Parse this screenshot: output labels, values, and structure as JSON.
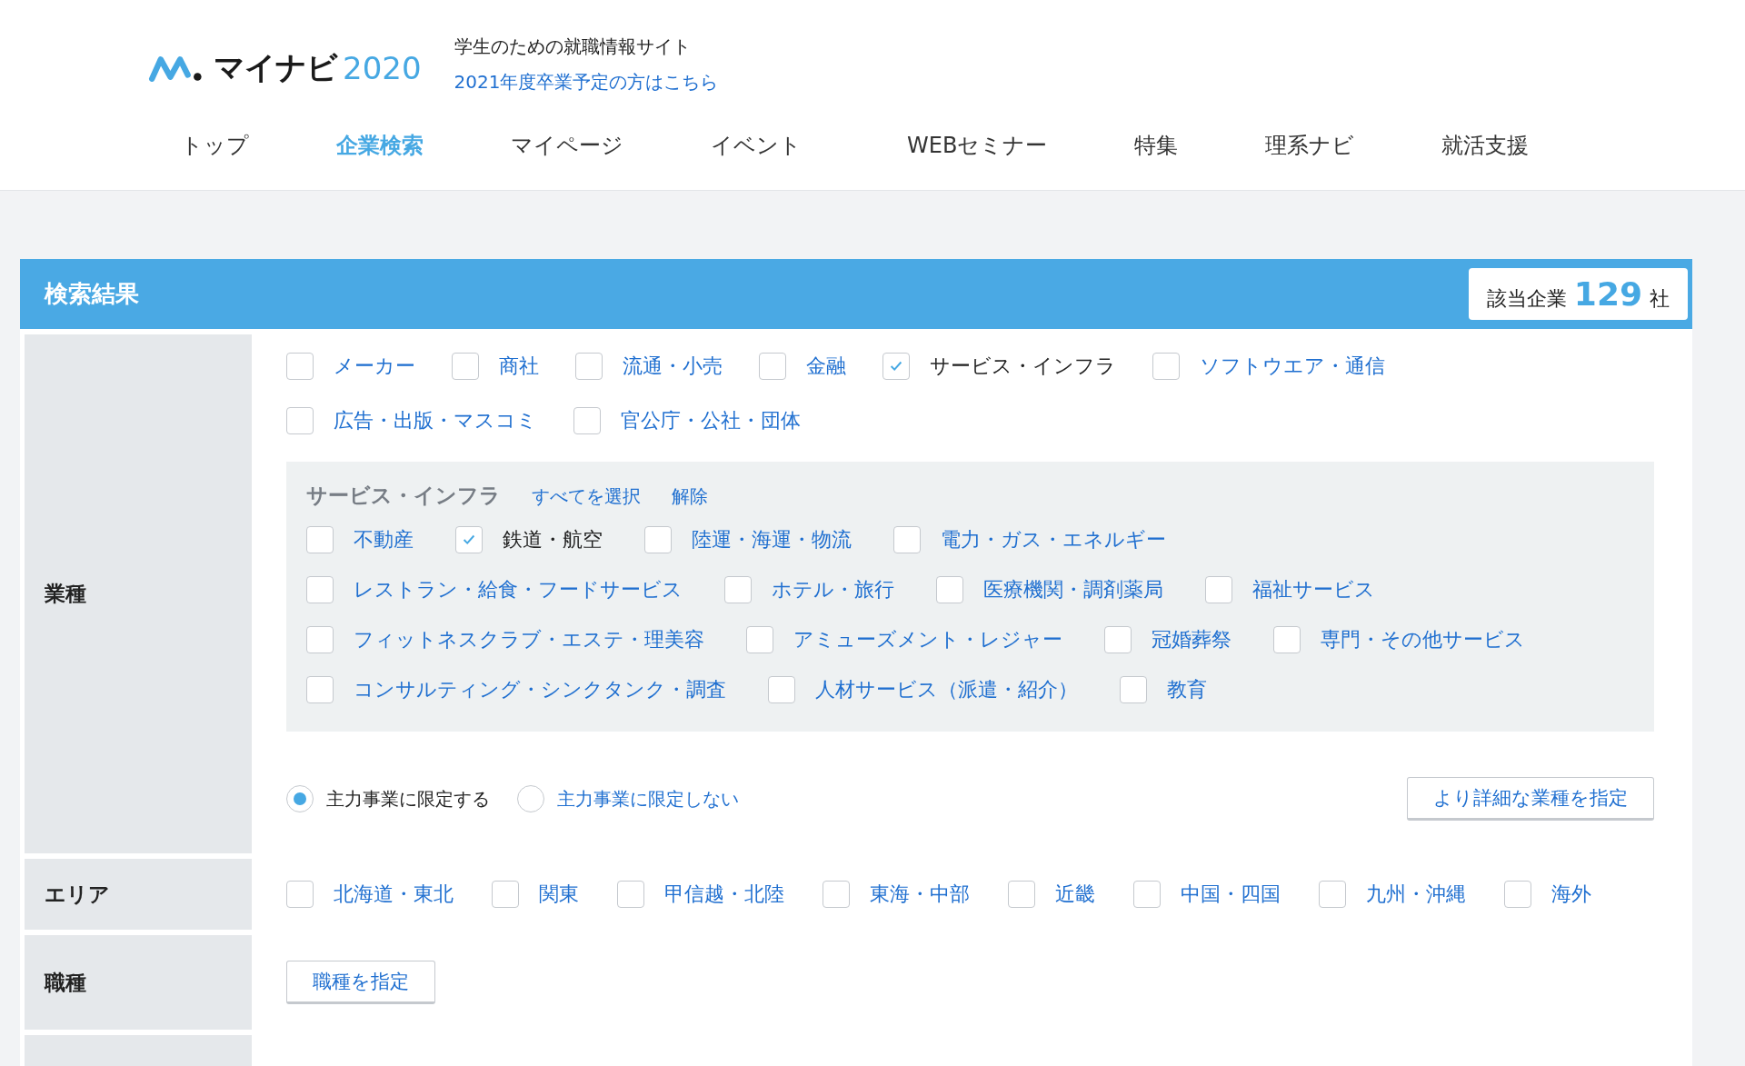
{
  "header": {
    "logo_text": "マイナビ",
    "logo_year": "2020",
    "tagline": "学生のための就職情報サイト",
    "next_year_link": "2021年度卒業予定の方はこちら"
  },
  "nav": [
    {
      "label": "トップ",
      "selected": false
    },
    {
      "label": "企業検索",
      "selected": true
    },
    {
      "label": "マイページ",
      "selected": false
    },
    {
      "label": "イベント",
      "selected": false
    },
    {
      "label": "WEBセミナー",
      "selected": false
    },
    {
      "label": "特集",
      "selected": false
    },
    {
      "label": "理系ナビ",
      "selected": false
    },
    {
      "label": "就活支援",
      "selected": false
    }
  ],
  "results": {
    "title": "検索結果",
    "count_label": "該当企業",
    "count": "129",
    "count_unit": "社"
  },
  "industry": {
    "label": "業種",
    "categories": [
      {
        "label": "メーカー",
        "checked": false
      },
      {
        "label": "商社",
        "checked": false
      },
      {
        "label": "流通・小売",
        "checked": false
      },
      {
        "label": "金融",
        "checked": false
      },
      {
        "label": "サービス・インフラ",
        "checked": true
      },
      {
        "label": "ソフトウエア・通信",
        "checked": false
      },
      {
        "label": "広告・出版・マスコミ",
        "checked": false
      },
      {
        "label": "官公庁・公社・団体",
        "checked": false
      }
    ],
    "sub": {
      "title": "サービス・インフラ",
      "select_all": "すべてを選択",
      "clear": "解除",
      "items": [
        {
          "label": "不動産",
          "checked": false
        },
        {
          "label": "鉄道・航空",
          "checked": true
        },
        {
          "label": "陸運・海運・物流",
          "checked": false
        },
        {
          "label": "電力・ガス・エネルギー",
          "checked": false
        },
        {
          "label": "レストラン・給食・フードサービス",
          "checked": false
        },
        {
          "label": "ホテル・旅行",
          "checked": false
        },
        {
          "label": "医療機関・調剤薬局",
          "checked": false
        },
        {
          "label": "福祉サービス",
          "checked": false
        },
        {
          "label": "フィットネスクラブ・エステ・理美容",
          "checked": false
        },
        {
          "label": "アミューズメント・レジャー",
          "checked": false
        },
        {
          "label": "冠婚葬祭",
          "checked": false
        },
        {
          "label": "専門・その他サービス",
          "checked": false
        },
        {
          "label": "コンサルティング・シンクタンク・調査",
          "checked": false
        },
        {
          "label": "人材サービス（派遣・紹介）",
          "checked": false
        },
        {
          "label": "教育",
          "checked": false
        }
      ]
    },
    "scope": [
      {
        "label": "主力事業に限定する",
        "selected": true
      },
      {
        "label": "主力事業に限定しない",
        "selected": false
      }
    ],
    "detail_button": "より詳細な業種を指定"
  },
  "area": {
    "label": "エリア",
    "items": [
      {
        "label": "北海道・東北",
        "checked": false
      },
      {
        "label": "関東",
        "checked": false
      },
      {
        "label": "甲信越・北陸",
        "checked": false
      },
      {
        "label": "東海・中部",
        "checked": false
      },
      {
        "label": "近畿",
        "checked": false
      },
      {
        "label": "中国・四国",
        "checked": false
      },
      {
        "label": "九州・沖縄",
        "checked": false
      },
      {
        "label": "海外",
        "checked": false
      }
    ]
  },
  "job": {
    "label": "職種",
    "button": "職種を指定"
  }
}
